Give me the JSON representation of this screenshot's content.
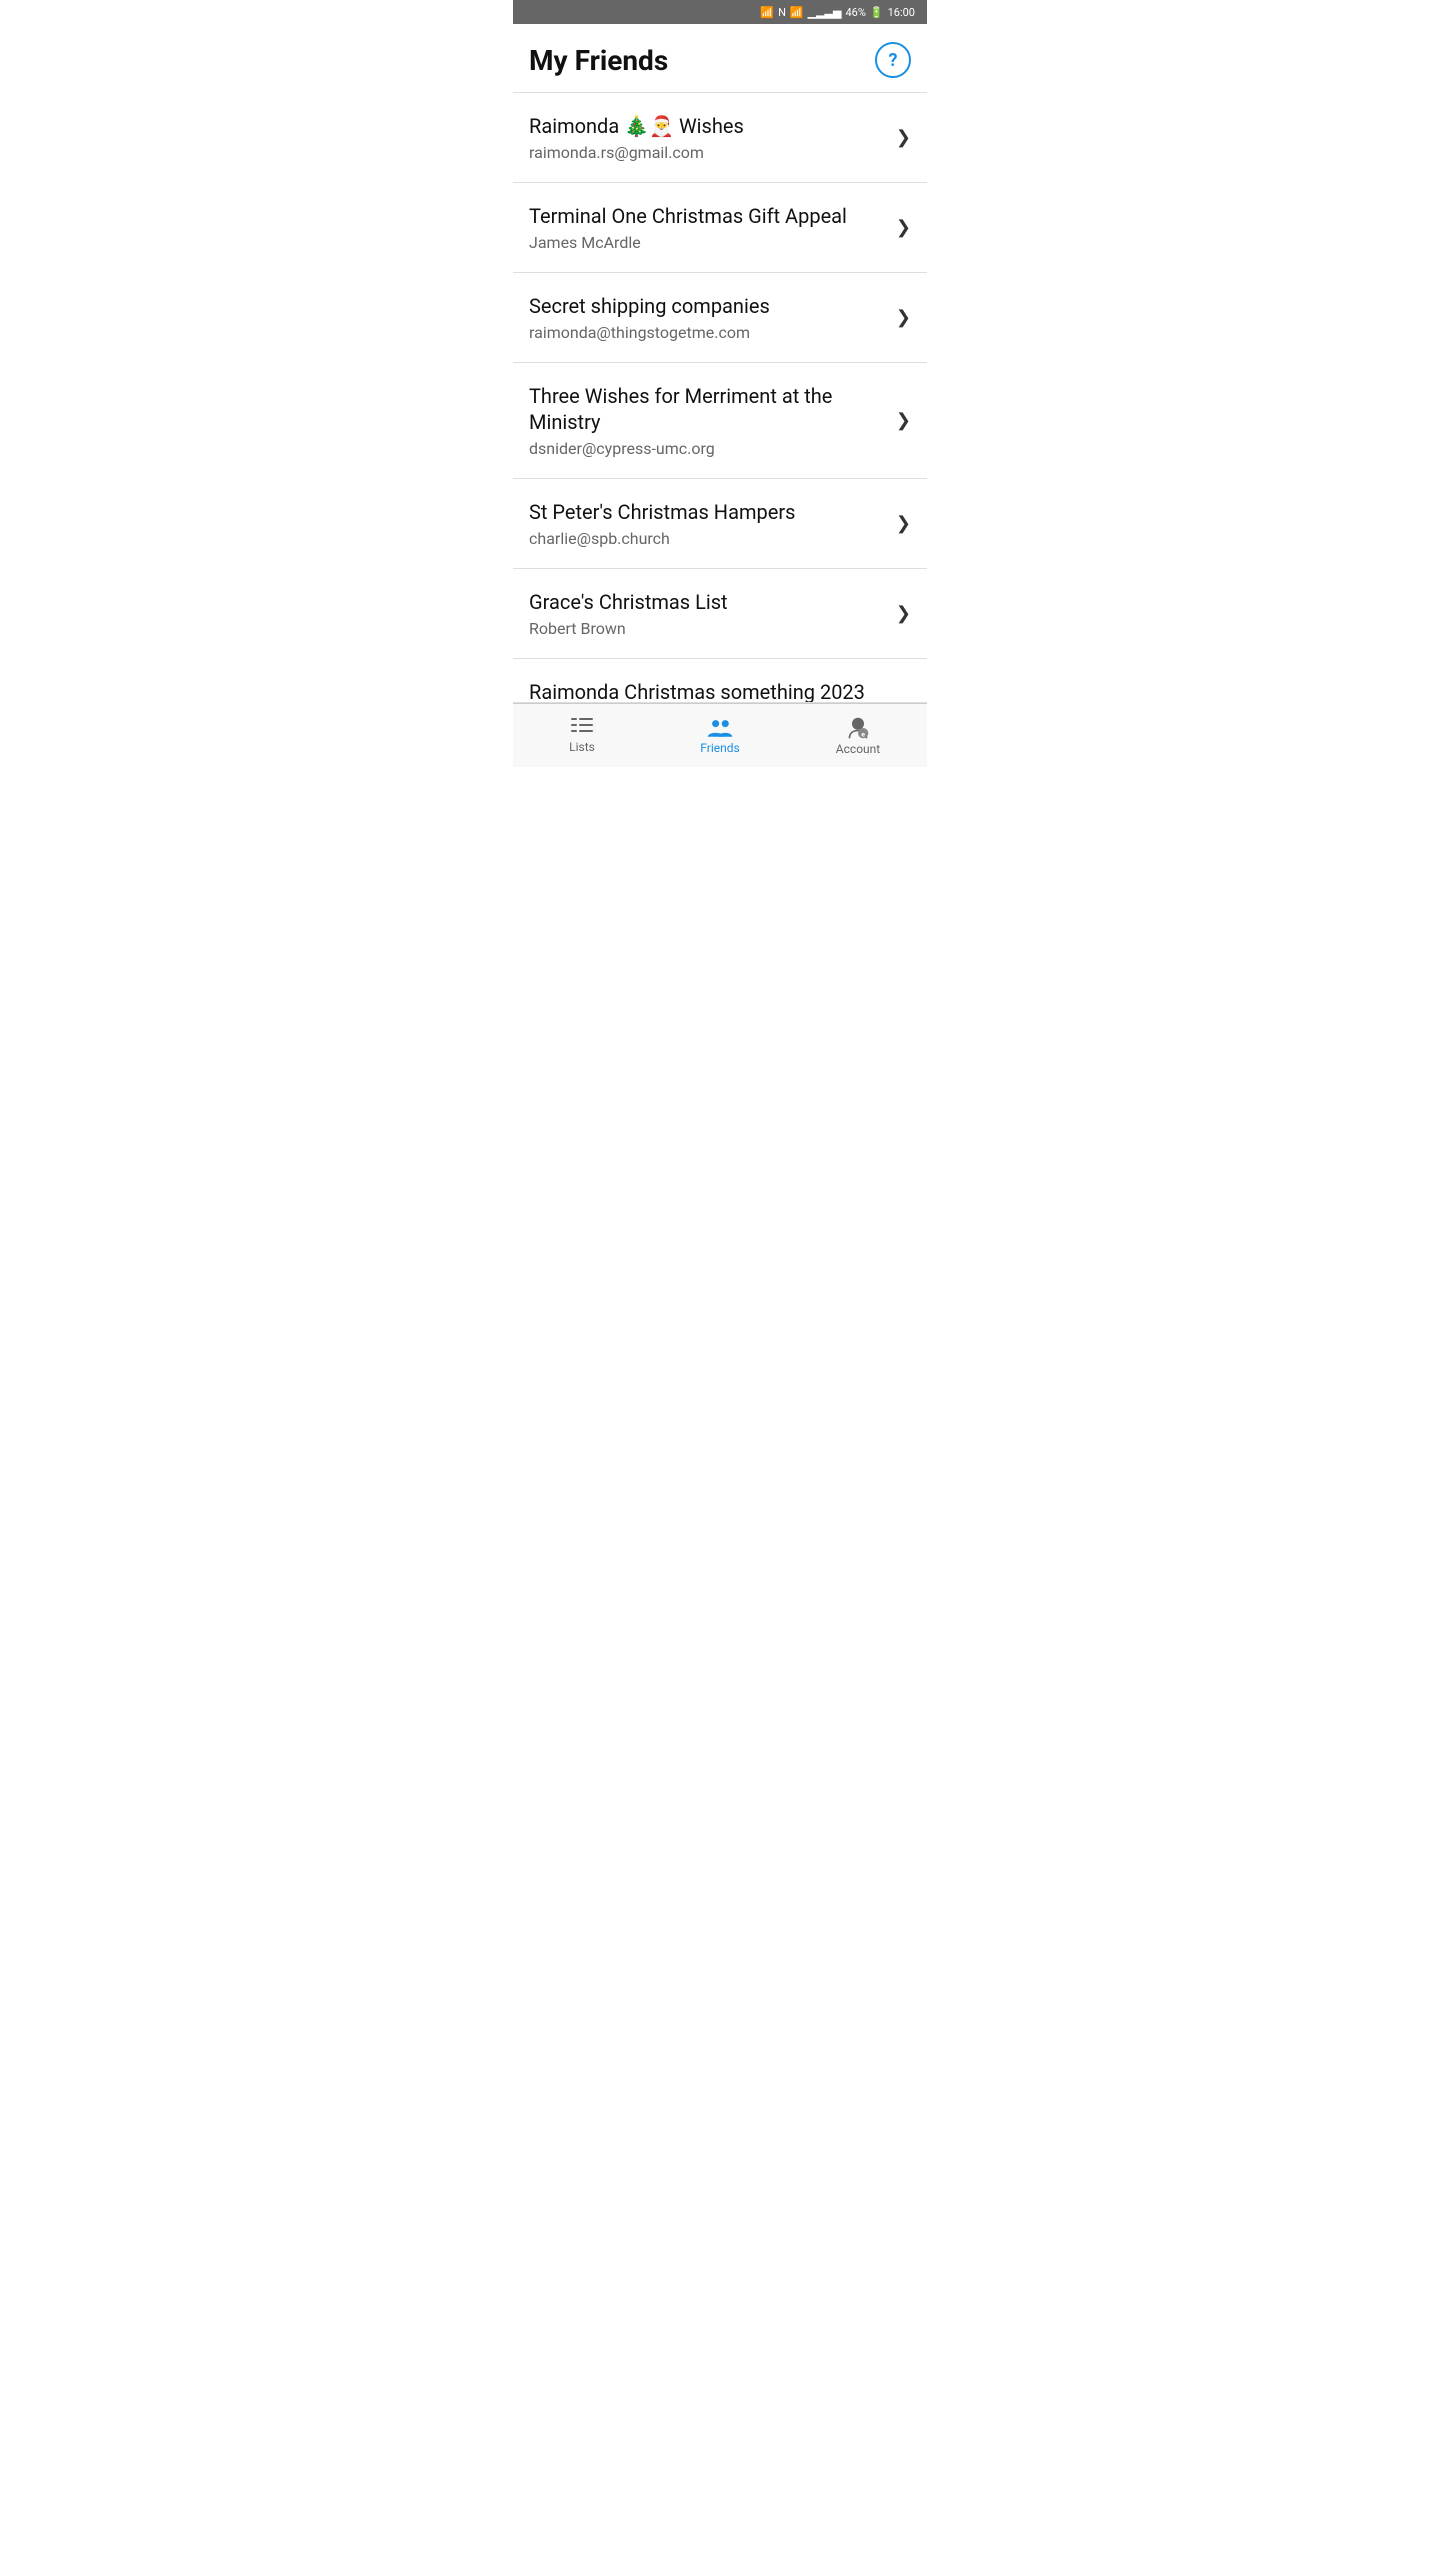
{
  "statusBar": {
    "battery": "46%",
    "time": "16:00"
  },
  "header": {
    "title": "My Friends",
    "helpLabel": "?"
  },
  "friends": [
    {
      "id": 1,
      "name": "Raimonda 🎄🎅 Wishes",
      "email": "raimonda.rs@gmail.com"
    },
    {
      "id": 2,
      "name": "Terminal One Christmas Gift Appeal",
      "email": "James McArdle"
    },
    {
      "id": 3,
      "name": "Secret shipping companies",
      "email": "raimonda@thingstogetme.com"
    },
    {
      "id": 4,
      "name": "Three Wishes for Merriment at the Ministry",
      "email": "dsnider@cypress-umc.org"
    },
    {
      "id": 5,
      "name": "St Peter's Christmas Hampers",
      "email": "charlie@spb.church"
    },
    {
      "id": 6,
      "name": "Grace's Christmas List",
      "email": "Robert Brown"
    }
  ],
  "partialItem": {
    "name": "Raimonda Christmas something 2023"
  },
  "nav": {
    "items": [
      {
        "id": "lists",
        "label": "Lists",
        "active": false
      },
      {
        "id": "friends",
        "label": "Friends",
        "active": true
      },
      {
        "id": "account",
        "label": "Account",
        "active": false
      }
    ]
  }
}
